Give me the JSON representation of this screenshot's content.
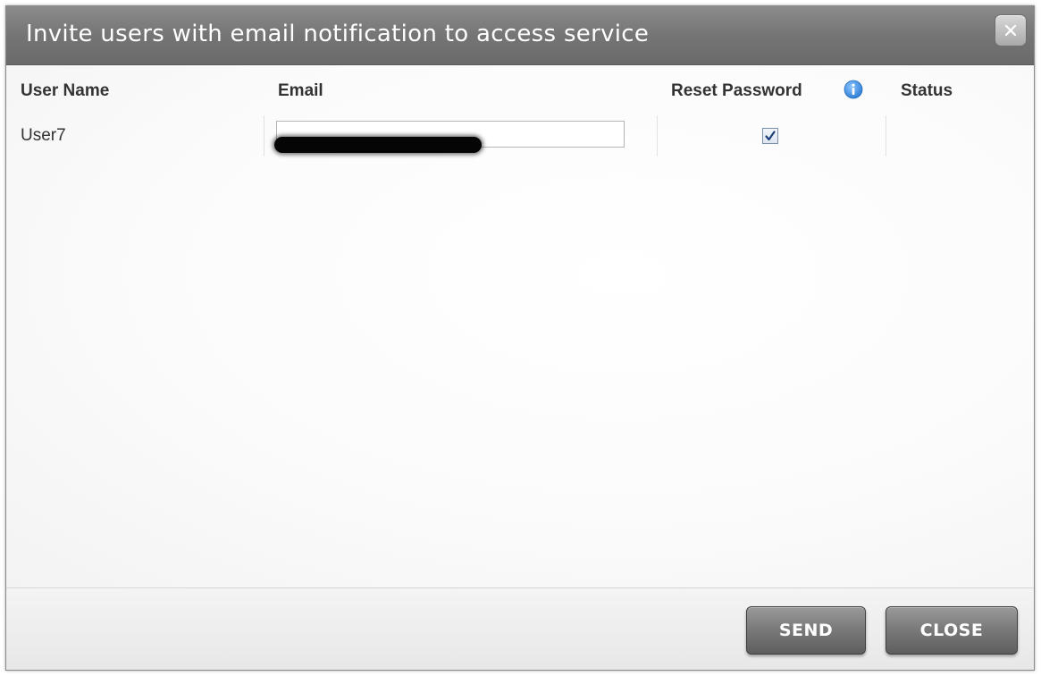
{
  "dialog": {
    "title": "Invite users with email notification to access service",
    "close_icon": "close-x-icon"
  },
  "table": {
    "headers": {
      "username": "User Name",
      "email": "Email",
      "reset_password": "Reset Password",
      "status": "Status"
    },
    "info_icon": "info-icon",
    "rows": [
      {
        "username": "User7",
        "email": "",
        "reset_password": true,
        "status": ""
      }
    ]
  },
  "footer": {
    "send_label": "SEND",
    "close_label": "CLOSE"
  },
  "colors": {
    "titlebar": "#767576",
    "info_blue": "#3d8fe0",
    "check_blue": "#1f3f7a",
    "button_gray": "#6e6e6e"
  }
}
